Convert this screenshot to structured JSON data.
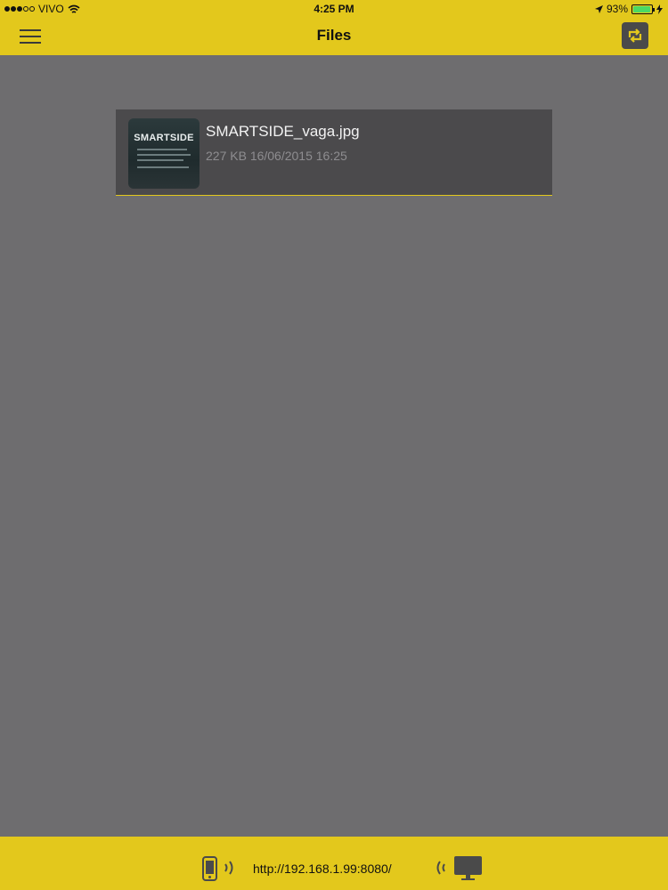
{
  "status_bar": {
    "carrier": "VIVO",
    "time": "4:25 PM",
    "battery_percent": "93%",
    "battery_level": 0.93,
    "signal_bars_on": 3,
    "signal_bars_total": 5
  },
  "nav": {
    "title": "Files",
    "menu_icon": "hamburger-icon",
    "refresh_icon": "refresh-icon"
  },
  "files": [
    {
      "name": "SMARTSIDE_vaga.jpg",
      "meta": "227 KB 16/06/2015 16:25",
      "thumbnail_text": "SMARTSIDE"
    }
  ],
  "bottom_bar": {
    "url": "http://192.168.1.99:8080/",
    "left_icon": "phone-icon",
    "right_icon": "monitor-icon"
  },
  "colors": {
    "accent": "#e3c81c",
    "background": "#6e6d6f",
    "card": "#4b4a4c"
  }
}
